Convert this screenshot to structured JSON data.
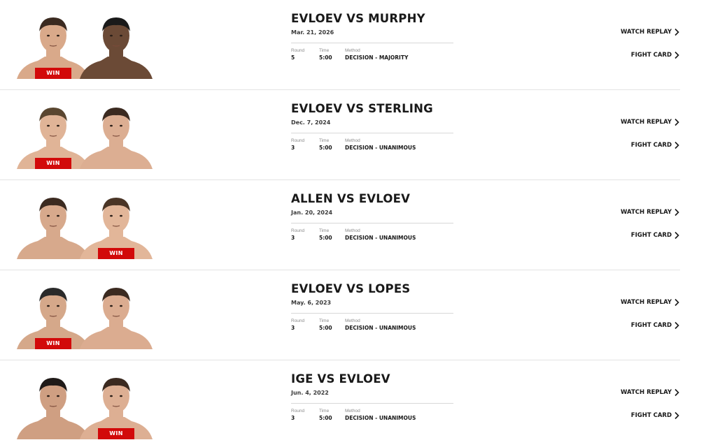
{
  "colors": {
    "accent": "#d20a0a",
    "text": "#191919",
    "muted": "#8a8a8a",
    "divider": "#e3e3e3"
  },
  "labels": {
    "round": "Round",
    "time": "Time",
    "method": "Method",
    "win": "WIN",
    "watch_replay": "WATCH REPLAY",
    "fight_card": "FIGHT CARD"
  },
  "fights": [
    {
      "headline": "EVLOEV VS MURPHY",
      "date": "Mar. 21, 2026",
      "round": "5",
      "time": "5:00",
      "method": "DECISION - MAJORITY",
      "winner": "left"
    },
    {
      "headline": "EVLOEV VS STERLING",
      "date": "Dec. 7, 2024",
      "round": "3",
      "time": "5:00",
      "method": "DECISION - UNANIMOUS",
      "winner": "left"
    },
    {
      "headline": "ALLEN VS EVLOEV",
      "date": "Jan. 20, 2024",
      "round": "3",
      "time": "5:00",
      "method": "DECISION - UNANIMOUS",
      "winner": "right"
    },
    {
      "headline": "EVLOEV VS LOPES",
      "date": "May. 6, 2023",
      "round": "3",
      "time": "5:00",
      "method": "DECISION - UNANIMOUS",
      "winner": "left"
    },
    {
      "headline": "IGE VS EVLOEV",
      "date": "Jun. 4, 2022",
      "round": "3",
      "time": "5:00",
      "method": "DECISION - UNANIMOUS",
      "winner": "right"
    }
  ]
}
